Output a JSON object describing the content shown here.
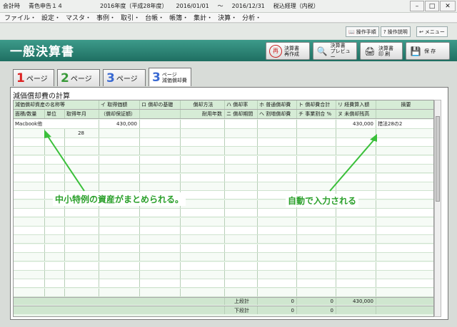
{
  "titlebar": {
    "app": "会計時",
    "product": "青色申告１４",
    "year": "2016年度（平成28年度）",
    "from": "2016/01/01",
    "tilde": "～",
    "to": "2016/12/31",
    "tax": "税込経理（内税）"
  },
  "menu": [
    "ファイル・",
    "設定・",
    "マスタ・",
    "事例・",
    "取引・",
    "台帳・",
    "帳簿・",
    "集計・",
    "決算・",
    "分析・"
  ],
  "toolbar": {
    "ops": "操作手順",
    "help": "操作説明",
    "menu": "メニュー"
  },
  "banner": {
    "title": "一般決算書"
  },
  "bigbuttons": [
    {
      "l1": "決算書",
      "l2": "再作成",
      "icon": "再"
    },
    {
      "l1": "決算書",
      "l2": "プレビュー",
      "icon": "🔍"
    },
    {
      "l1": "決算書",
      "l2": "印 刷",
      "icon": "🖨"
    },
    {
      "l1": "保 存",
      "l2": "",
      "icon": "💾"
    }
  ],
  "tabs": [
    {
      "num": "1",
      "label": "ページ"
    },
    {
      "num": "2",
      "label": "ページ"
    },
    {
      "num": "3",
      "label": "ページ"
    },
    {
      "num": "3",
      "label": "ページ",
      "sub": "減価償却費"
    }
  ],
  "panel": {
    "title": "減価償却費の計算"
  },
  "headers": {
    "row1": [
      "減価償却資産の名称等",
      "イ 取得価額",
      "ロ 償却の基礎",
      "償却方法",
      "ハ 償却率",
      "ホ 普通償却費",
      "ト 償却費合計",
      "リ 経費算入額",
      "摘要"
    ],
    "row2": [
      "面積/数量",
      "単位",
      "取得年月",
      "（償却保証額）",
      "",
      "耐用年数",
      "ニ 償却期間",
      "ヘ 割増償却費",
      "チ 事業割合 %",
      "ヌ 未償却残高",
      ""
    ]
  },
  "data_row": {
    "name": "Macbook他",
    "cost": "430,000",
    "expense": "430,000",
    "note": "措法28の2",
    "month": "28"
  },
  "footer": {
    "upper_label": "上段計",
    "lower_label": "下段計",
    "u1": "0",
    "u2": "0",
    "u3": "430,000",
    "l1": "0",
    "l2": "0"
  },
  "callouts": {
    "left": "中小特例の資産がまとめられる。",
    "right": "自動で入力される"
  },
  "colors": {
    "banner": "#2f8a7a",
    "grid": "#eaf6ea",
    "callout": "#2aa02a"
  }
}
